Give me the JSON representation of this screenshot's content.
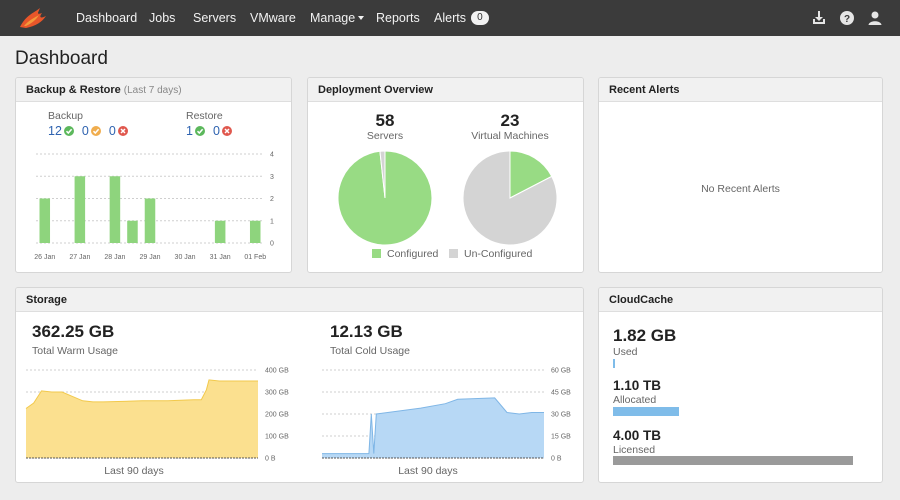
{
  "nav": {
    "items": [
      {
        "label": "Dashboard"
      },
      {
        "label": "Jobs"
      },
      {
        "label": "Servers"
      },
      {
        "label": "VMware"
      },
      {
        "label": "Manage"
      },
      {
        "label": "Reports"
      },
      {
        "label": "Alerts",
        "badge": "0"
      }
    ],
    "icons": [
      "download-icon",
      "help-icon",
      "user-icon"
    ]
  },
  "page": {
    "title": "Dashboard"
  },
  "colors": {
    "nav_bg": "#3b3b3b",
    "ok": "#5cb85c",
    "warn": "#f0ad4e",
    "err": "#e0584e",
    "bar_green": "#8ed47d",
    "pie_green": "#98db84",
    "pie_grey": "#d4d4d4",
    "warm_fill": "#fbe08f",
    "cold_fill": "#b7d8f5",
    "bar_blue": "#7fbce9",
    "bar_grey": "#9a9a9a"
  },
  "backup_restore": {
    "title": "Backup & Restore",
    "subtitle": "(Last 7 days)",
    "backup_label": "Backup",
    "restore_label": "Restore",
    "backup_ok": "12",
    "backup_warn": "0",
    "backup_err": "0",
    "restore_ok": "1",
    "restore_err": "0"
  },
  "deployment": {
    "title": "Deployment Overview",
    "servers_count": "58",
    "servers_label": "Servers",
    "vms_count": "23",
    "vms_label": "Virtual Machines",
    "legend_configured": "Configured",
    "legend_unconfigured": "Un-Configured"
  },
  "alerts": {
    "title": "Recent Alerts",
    "empty_text": "No Recent Alerts"
  },
  "storage": {
    "title": "Storage",
    "warm_value": "362.25 GB",
    "warm_label": "Total Warm Usage",
    "warm_xlabel": "Last 90 days",
    "cold_value": "12.13 GB",
    "cold_label": "Total Cold Usage",
    "cold_xlabel": "Last 90 days"
  },
  "cloudcache": {
    "title": "CloudCache",
    "used_value": "1.82 GB",
    "used_label": "Used",
    "allocated_value": "1.10 TB",
    "allocated_label": "Allocated",
    "licensed_value": "4.00 TB",
    "licensed_label": "Licensed",
    "used_fraction": 0.0004,
    "allocated_fraction": 0.275,
    "licensed_fraction": 1.0
  },
  "chart_data": [
    {
      "type": "bar",
      "categories": [
        "26 Jan",
        "",
        "27 Jan",
        "",
        "28 Jan",
        "",
        "29 Jan",
        "",
        "30 Jan",
        "",
        "31 Jan",
        "",
        "01 Feb"
      ],
      "values": [
        2,
        0,
        3,
        0,
        3,
        1,
        2,
        0,
        0,
        0,
        1,
        0,
        1
      ],
      "y_ticks": [
        "4",
        "3",
        "2",
        "1",
        "0"
      ],
      "ylim": [
        0,
        4
      ],
      "grid": true
    },
    {
      "type": "pie",
      "labels": [
        "Configured",
        "Un-Configured"
      ],
      "values": [
        57,
        1
      ]
    },
    {
      "type": "pie",
      "labels": [
        "Configured",
        "Un-Configured"
      ],
      "values": [
        4,
        19
      ]
    },
    {
      "type": "area",
      "x": [
        0,
        3,
        6,
        10,
        14,
        18,
        22,
        26,
        30,
        45,
        55,
        65,
        68,
        70,
        71,
        75,
        80,
        90
      ],
      "values": [
        225,
        250,
        305,
        300,
        300,
        280,
        260,
        255,
        255,
        260,
        260,
        265,
        265,
        310,
        355,
        350,
        350,
        350
      ],
      "y_ticks": [
        "400 GB",
        "300 GB",
        "200 GB",
        "100 GB",
        "0 B"
      ],
      "ylim": [
        0,
        400
      ],
      "xlabel": "Last 90 days"
    },
    {
      "type": "area",
      "x": [
        0,
        8,
        18,
        19,
        20,
        21,
        22,
        40,
        50,
        55,
        70,
        75,
        80,
        85,
        90
      ],
      "values": [
        3,
        3,
        3,
        3,
        30,
        3,
        30,
        34,
        37,
        40,
        41,
        31,
        30,
        31,
        31
      ],
      "y_ticks": [
        "60 GB",
        "45 GB",
        "30 GB",
        "15 GB",
        "0 B"
      ],
      "ylim": [
        0,
        60
      ],
      "xlabel": "Last 90 days"
    }
  ]
}
